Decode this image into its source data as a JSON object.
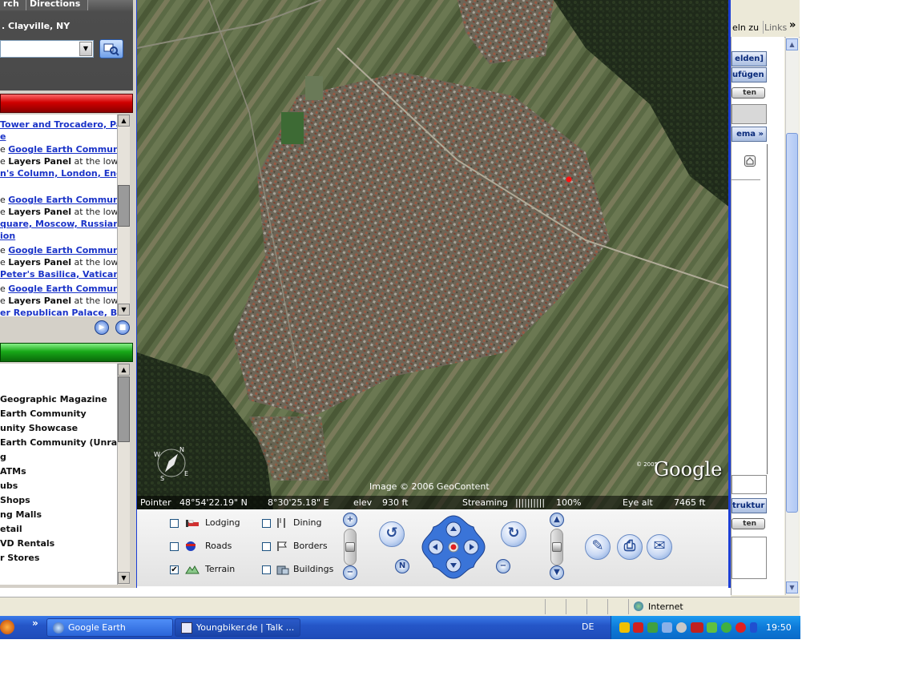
{
  "left_panel": {
    "tabs": [
      "rch",
      "Directions"
    ],
    "search_location": ". Clayville, NY",
    "places_list": [
      [
        {
          "t": "Tower and Trocadero, Pari",
          "c": "lnk"
        }
      ],
      [
        {
          "t": "e",
          "c": "lnk"
        }
      ],
      [
        {
          "t": "e ",
          "c": "dk"
        },
        {
          "t": "Google Earth Community",
          "c": "lnk"
        }
      ],
      [
        {
          "t": "e ",
          "c": "dk"
        },
        {
          "t": "Layers Panel",
          "c": "dkb"
        },
        {
          "t": " at the lower",
          "c": "dk"
        }
      ],
      [
        {
          "t": "n's Column, London, Engla",
          "c": "lnk"
        }
      ],
      [
        {
          "t": "",
          "c": "dk"
        }
      ],
      [
        {
          "t": "e ",
          "c": "dk"
        },
        {
          "t": "Google Earth Community",
          "c": "lnk"
        }
      ],
      [
        {
          "t": "e ",
          "c": "dk"
        },
        {
          "t": "Layers Panel",
          "c": "dkb"
        },
        {
          "t": " at the lower",
          "c": "dk"
        }
      ],
      [
        {
          "t": "quare, Moscow, Russian F",
          "c": "lnk"
        }
      ],
      [
        {
          "t": "ion",
          "c": "lnk"
        }
      ],
      [
        {
          "t": "e ",
          "c": "dk"
        },
        {
          "t": "Google Earth Community",
          "c": "lnk"
        }
      ],
      [
        {
          "t": "e ",
          "c": "dk"
        },
        {
          "t": "Layers Panel",
          "c": "dkb"
        },
        {
          "t": " at the lower",
          "c": "dk"
        }
      ],
      [
        {
          "t": "Peter's Basilica, Vatican Ci",
          "c": "lnk"
        }
      ],
      [
        {
          "t": "e ",
          "c": "dk"
        },
        {
          "t": "Google Earth Community",
          "c": "lnk"
        }
      ],
      [
        {
          "t": "e ",
          "c": "dk"
        },
        {
          "t": "Layers Panel",
          "c": "dkb"
        },
        {
          "t": " at the lower",
          "c": "dk"
        }
      ],
      [
        {
          "t": "er Republican Palace, Bagd",
          "c": "lnk"
        }
      ]
    ],
    "layers_list": [
      "Geographic Magazine",
      "Earth Community",
      "unity Showcase",
      "Earth Community (Unranke",
      "g",
      "ATMs",
      "ubs",
      "Shops",
      "ng Malls",
      "etail",
      "VD Rentals",
      "r Stores"
    ]
  },
  "map": {
    "image_credit": "Image © 2006 GeoContent",
    "google_logo": "Google",
    "copyright_small": "© 2005",
    "status": {
      "pointer_label": "Pointer",
      "lat": "48°54'22.19\"  N",
      "lon": "8°30'25.18\"  E",
      "elev_label": "elev",
      "elev": "930 ft",
      "streaming_label": "Streaming",
      "streaming_bars": "||||||||||",
      "streaming_pct": "100%",
      "eye_label": "Eye  alt",
      "eye_alt": "7465 ft"
    }
  },
  "layers": {
    "lodging": {
      "label": "Lodging",
      "checked": false
    },
    "roads": {
      "label": "Roads",
      "checked": false
    },
    "terrain": {
      "label": "Terrain",
      "checked": true
    },
    "dining": {
      "label": "Dining",
      "checked": false
    },
    "borders": {
      "label": "Borders",
      "checked": false
    },
    "buildings": {
      "label": "Buildings",
      "checked": false
    }
  },
  "browser": {
    "toolbar_text": "eln zu",
    "links_label": "Links",
    "links_chevron": "»",
    "buttons": [
      "elden]",
      "ufügen",
      "ten",
      "ema »",
      "truktur",
      "ten"
    ],
    "status_zone": "Internet"
  },
  "taskbar": {
    "chevron": "»",
    "tasks": [
      "Google Earth",
      "Youngbiker.de | Talk ..."
    ],
    "language": "DE",
    "clock": "19:50"
  },
  "colors": {
    "google_earth_frame": "#1c3ed6",
    "red_bar": "#d00000",
    "green_bar": "#18a818",
    "taskbar_blue": "#2556c8",
    "link_blue": "#1a33c8"
  }
}
